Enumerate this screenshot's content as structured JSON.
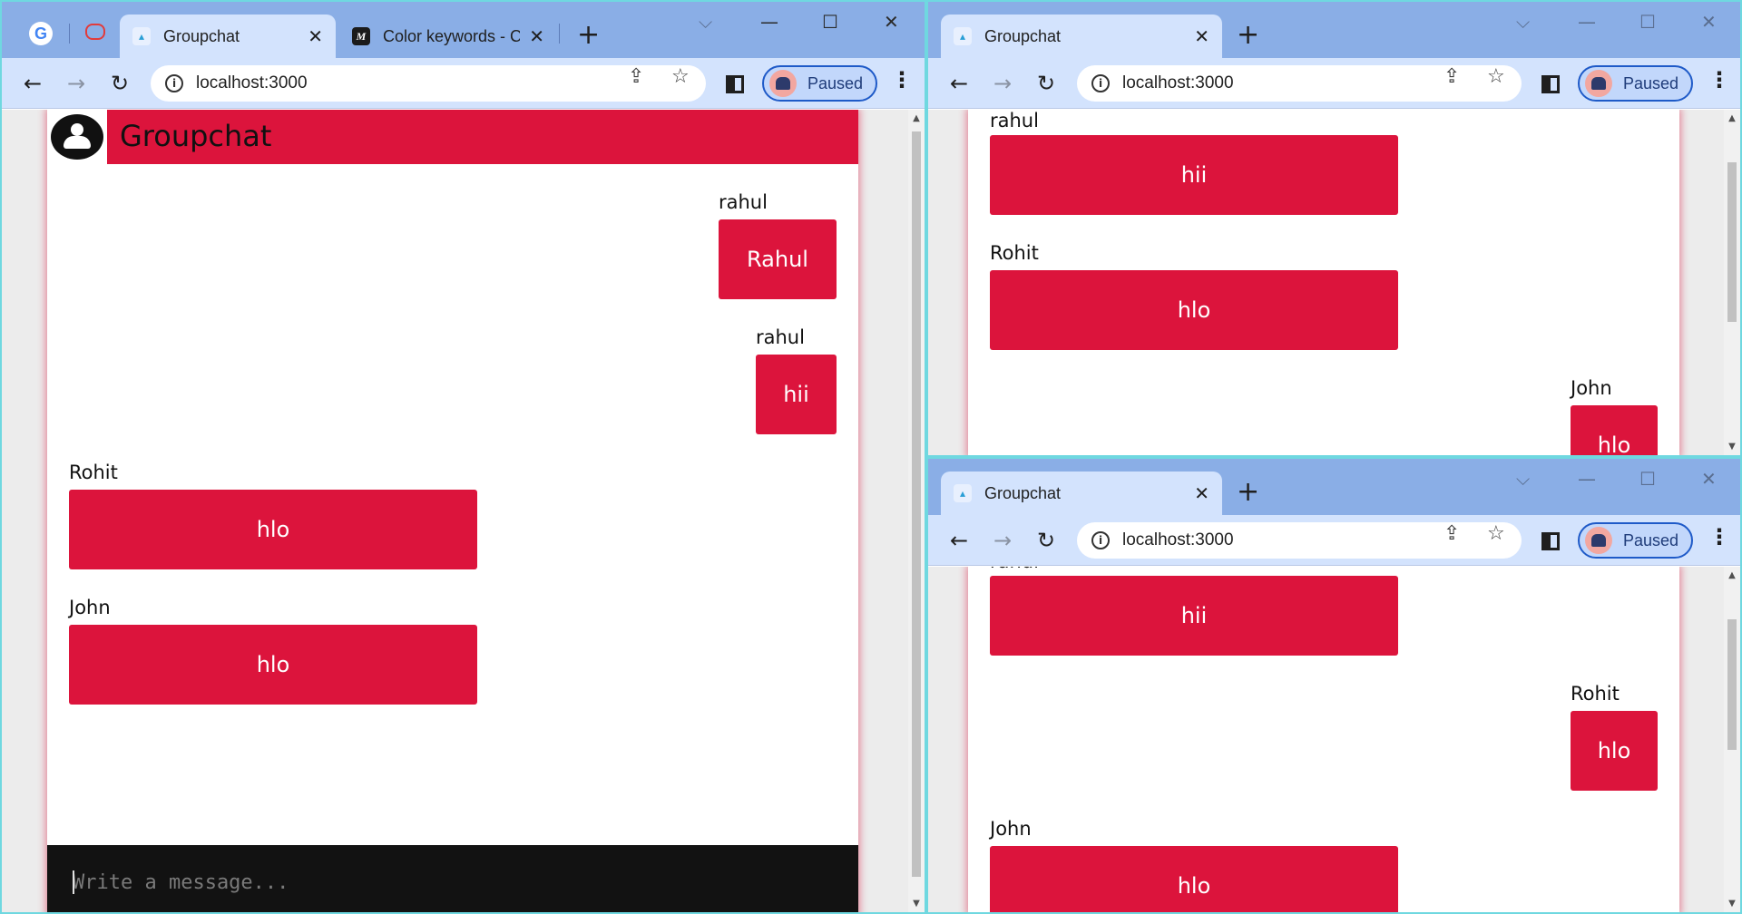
{
  "windows": {
    "left": {
      "tabs": [
        {
          "label": "Groupchat",
          "close": "✕"
        },
        {
          "label": "Color keywords - C",
          "close": "✕"
        }
      ],
      "url": "localhost:3000",
      "profile_label": "Paused",
      "app": {
        "title": "Groupchat",
        "messages": [
          {
            "sender": "rahul",
            "text": "Rahul",
            "align": "right"
          },
          {
            "sender": "rahul",
            "text": "hii",
            "align": "right"
          },
          {
            "sender": "Rohit",
            "text": "hlo",
            "align": "left"
          },
          {
            "sender": "John",
            "text": "hlo",
            "align": "left"
          }
        ],
        "composer_placeholder": "Write a message..."
      }
    },
    "top_right": {
      "tabs": [
        {
          "label": "Groupchat",
          "close": "✕"
        }
      ],
      "url": "localhost:3000",
      "profile_label": "Paused",
      "app": {
        "messages": [
          {
            "sender": "rahul",
            "text": "hii",
            "align": "left"
          },
          {
            "sender": "Rohit",
            "text": "hlo",
            "align": "left"
          },
          {
            "sender": "John",
            "text": "hlo",
            "align": "right"
          }
        ]
      }
    },
    "bottom_right": {
      "tabs": [
        {
          "label": "Groupchat",
          "close": "✕"
        }
      ],
      "url": "localhost:3000",
      "profile_label": "Paused",
      "app": {
        "messages": [
          {
            "sender": "rahul",
            "text": "hii",
            "align": "left"
          },
          {
            "sender": "Rohit",
            "text": "hlo",
            "align": "right"
          },
          {
            "sender": "John",
            "text": "hlo",
            "align": "left"
          }
        ]
      }
    }
  },
  "icons": {
    "back": "←",
    "forward": "→",
    "reload": "↻",
    "share": "⇪",
    "star": "☆",
    "new_tab": "+",
    "menu": "⋮",
    "minimize": "—",
    "maximize": "☐",
    "close": "✕",
    "dropdown": "⌵",
    "info": "i",
    "google": "G",
    "mdn": "M"
  },
  "colors": {
    "accent": "#dc143c",
    "tabbar": "#8aaee6",
    "toolbar": "#d3e3fd",
    "composer": "#121212"
  }
}
